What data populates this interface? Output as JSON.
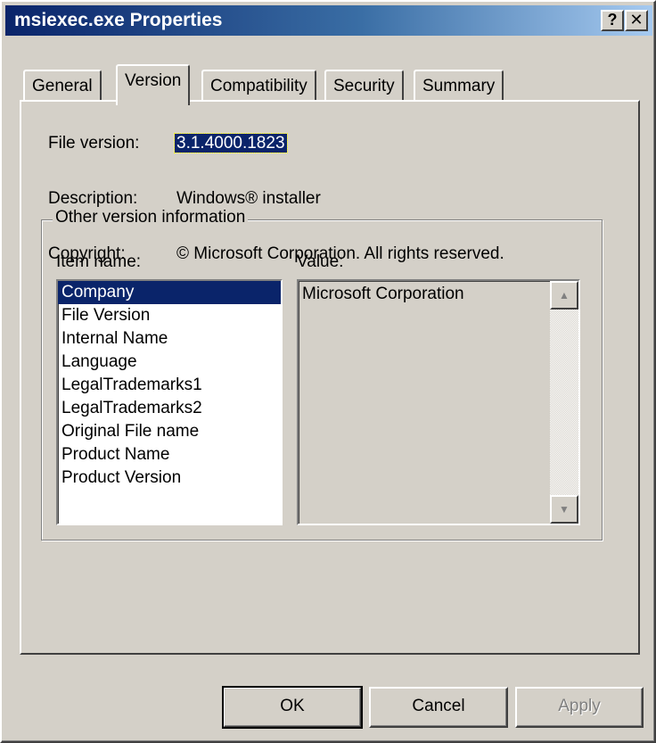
{
  "window": {
    "title": "msiexec.exe Properties",
    "help_glyph": "?",
    "close_glyph": "✕"
  },
  "tabs": [
    {
      "label": "General",
      "active": false
    },
    {
      "label": "Version",
      "active": true
    },
    {
      "label": "Compatibility",
      "active": false
    },
    {
      "label": "Security",
      "active": false
    },
    {
      "label": "Summary",
      "active": false
    }
  ],
  "fields": {
    "file_version": {
      "label": "File version:",
      "value": "3.1.4000.1823"
    },
    "description": {
      "label": "Description:",
      "value": "Windows® installer"
    },
    "copyright": {
      "label": "Copyright:",
      "value": "© Microsoft Corporation. All rights reserved."
    }
  },
  "other_info": {
    "group_label": "Other version information",
    "item_name_label": "Item name:",
    "value_label": "Value:",
    "items": [
      "Company",
      "File Version",
      "Internal Name",
      "Language",
      "LegalTrademarks1",
      "LegalTrademarks2",
      "Original File name",
      "Product Name",
      "Product Version"
    ],
    "selected_item": "Company",
    "value": "Microsoft Corporation"
  },
  "buttons": {
    "ok": "OK",
    "cancel": "Cancel",
    "apply": "Apply"
  },
  "icons": {
    "scroll_up": "triangle-up-icon",
    "scroll_down": "triangle-down-icon"
  },
  "colors": {
    "title_start": "#0a246a",
    "title_end": "#a6caf0",
    "selection": "#0a246a",
    "face": "#d4d0c8"
  }
}
